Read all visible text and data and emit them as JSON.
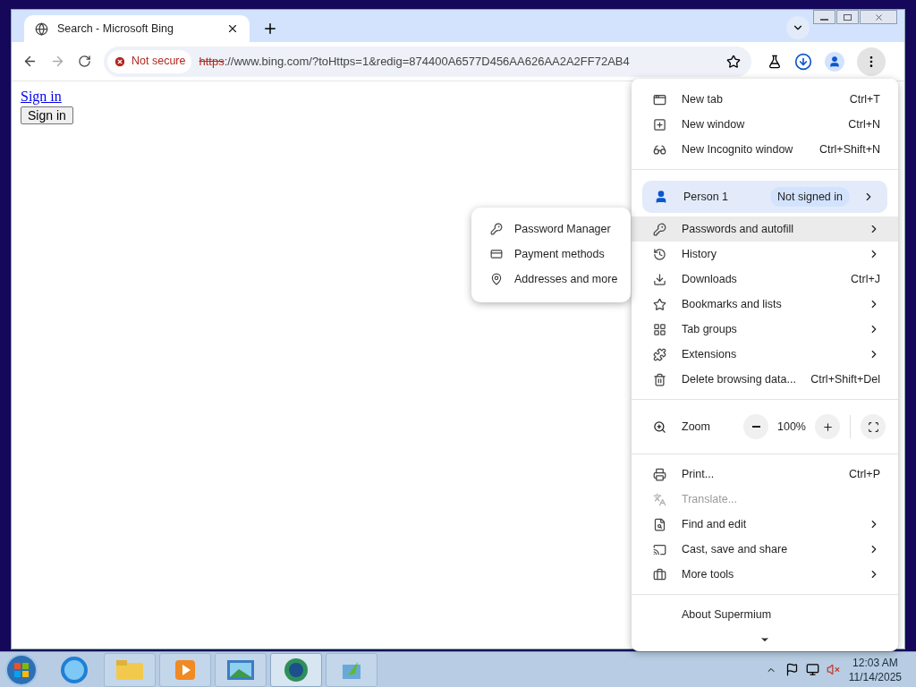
{
  "tab": {
    "title": "Search - Microsoft Bing"
  },
  "address_bar": {
    "security": "Not secure",
    "url_scheme": "https",
    "url_rest": "://www.bing.com/?toHttps=1&redig=874400A6577D456AA626AA2A2FF72AB4"
  },
  "page": {
    "link": "Sign in",
    "button": "Sign in"
  },
  "menu": {
    "sections": [
      [
        {
          "kind": "item",
          "label": "New tab",
          "shortcut": "Ctrl+T",
          "submenu": false,
          "disabled": false,
          "selected": false
        },
        {
          "kind": "item",
          "label": "New window",
          "shortcut": "Ctrl+N",
          "submenu": false,
          "disabled": false,
          "selected": false
        },
        {
          "kind": "item",
          "label": "New Incognito window",
          "shortcut": "Ctrl+Shift+N",
          "submenu": false,
          "disabled": false,
          "selected": false
        }
      ],
      [
        {
          "kind": "profile",
          "label": "Person 1",
          "status": "Not signed in",
          "submenu": true
        },
        {
          "kind": "item",
          "label": "Passwords and autofill",
          "submenu": true,
          "disabled": false,
          "selected": true
        },
        {
          "kind": "item",
          "label": "History",
          "submenu": true,
          "disabled": false,
          "selected": false
        },
        {
          "kind": "item",
          "label": "Downloads",
          "shortcut": "Ctrl+J",
          "submenu": false,
          "disabled": false,
          "selected": false
        },
        {
          "kind": "item",
          "label": "Bookmarks and lists",
          "submenu": true,
          "disabled": false,
          "selected": false
        },
        {
          "kind": "item",
          "label": "Tab groups",
          "submenu": true,
          "disabled": false,
          "selected": false
        },
        {
          "kind": "item",
          "label": "Extensions",
          "submenu": true,
          "disabled": false,
          "selected": false
        },
        {
          "kind": "item",
          "label": "Delete browsing data...",
          "shortcut": "Ctrl+Shift+Del",
          "submenu": false,
          "disabled": false,
          "selected": false
        }
      ],
      [
        {
          "kind": "zoom",
          "label": "Zoom",
          "value": "100%"
        }
      ],
      [
        {
          "kind": "item",
          "label": "Print...",
          "shortcut": "Ctrl+P",
          "submenu": false,
          "disabled": false,
          "selected": false
        },
        {
          "kind": "item",
          "label": "Translate...",
          "submenu": false,
          "disabled": true,
          "selected": false
        },
        {
          "kind": "item",
          "label": "Find and edit",
          "submenu": true,
          "disabled": false,
          "selected": false
        },
        {
          "kind": "item",
          "label": "Cast, save and share",
          "submenu": true,
          "disabled": false,
          "selected": false
        },
        {
          "kind": "item",
          "label": "More tools",
          "submenu": true,
          "disabled": false,
          "selected": false
        }
      ],
      [
        {
          "kind": "item",
          "label": "About Supermium",
          "submenu": false,
          "disabled": false,
          "selected": false
        }
      ]
    ]
  },
  "submenu": {
    "items": [
      "Password Manager",
      "Payment methods",
      "Addresses and more"
    ]
  },
  "taskbar": {
    "time": "12:03 AM",
    "date": "11/14/2025"
  }
}
